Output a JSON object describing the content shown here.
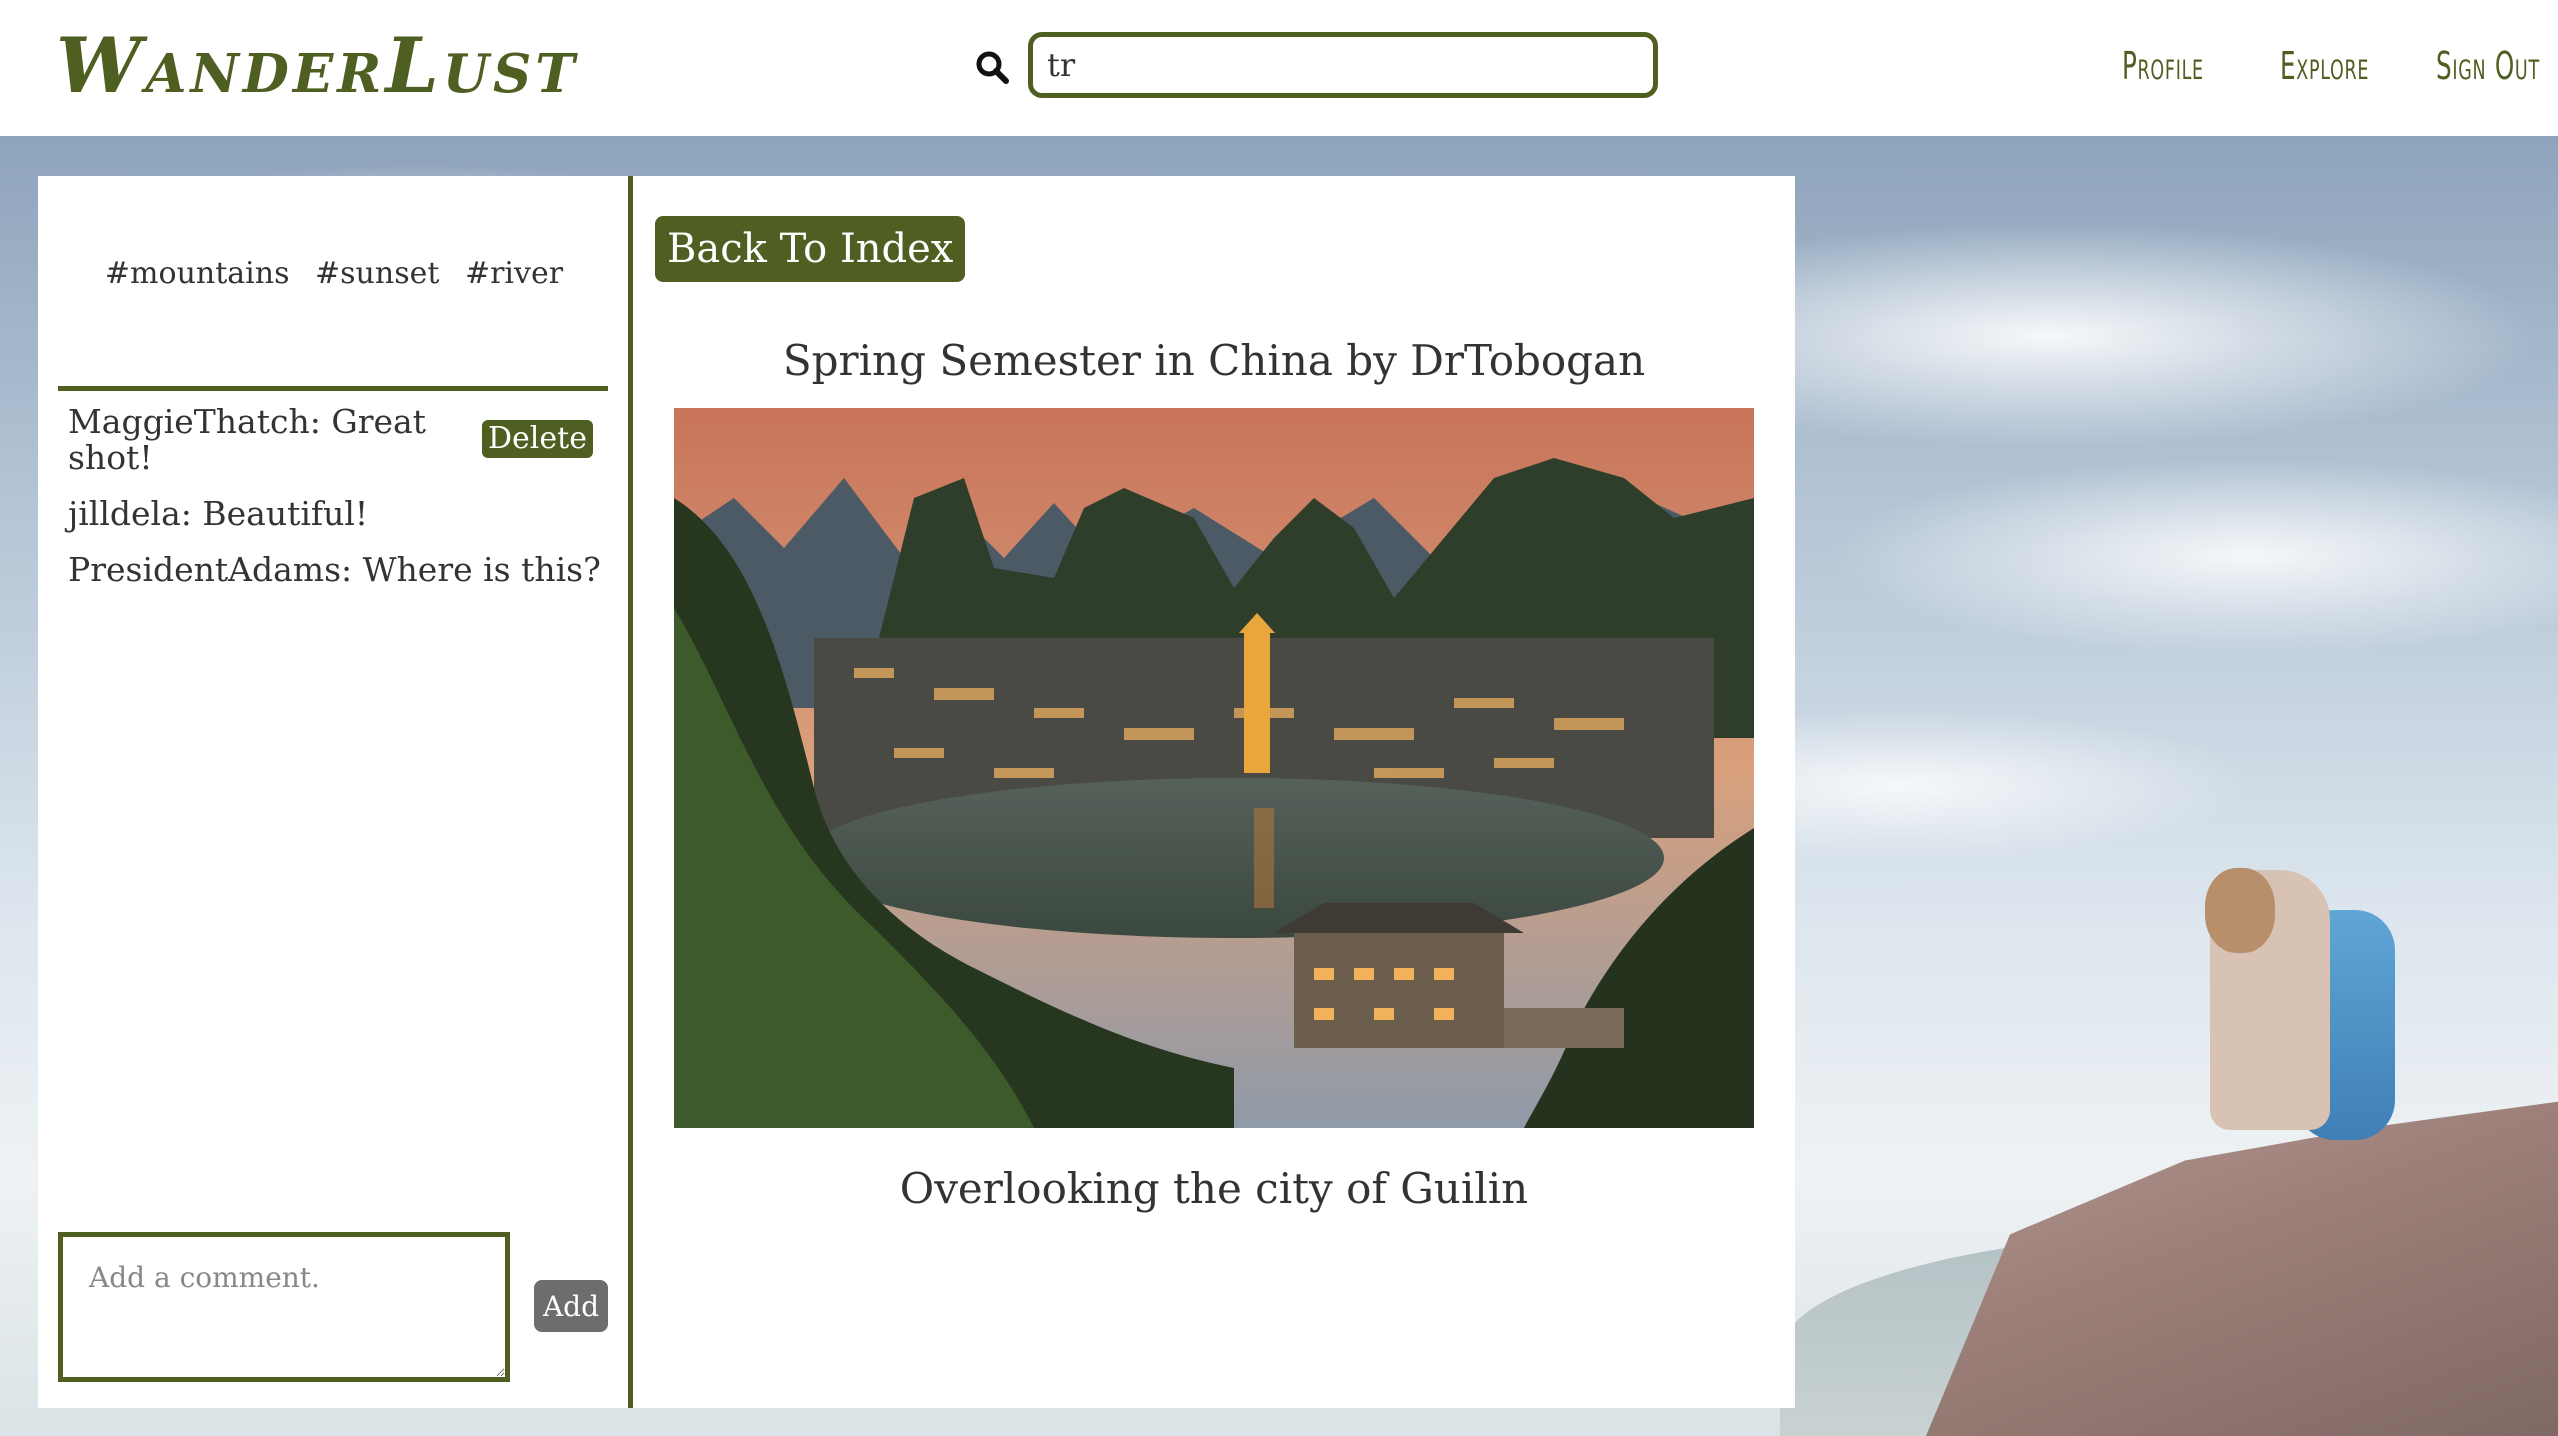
{
  "header": {
    "logo": "WanderLust",
    "search_value": "tr",
    "nav": [
      "Profile",
      "Explore",
      "Sign Out"
    ]
  },
  "sidebar": {
    "tags": [
      "#mountains",
      "#sunset",
      "#river"
    ],
    "comments": [
      {
        "text": "MaggieThatch: Great shot!",
        "deletable": true
      },
      {
        "text": "jilldela: Beautiful!"
      },
      {
        "text": "PresidentAdams: Where is this?"
      }
    ],
    "delete_label": "Delete",
    "comment_placeholder": "Add a comment.",
    "add_label": "Add"
  },
  "main": {
    "back_label": "Back To Index",
    "post_title": "Spring Semester in China by DrTobogan",
    "caption": "Overlooking the city of Guilin"
  },
  "colors": {
    "accent": "#4f5f22",
    "add_button": "#6d6d6d"
  }
}
